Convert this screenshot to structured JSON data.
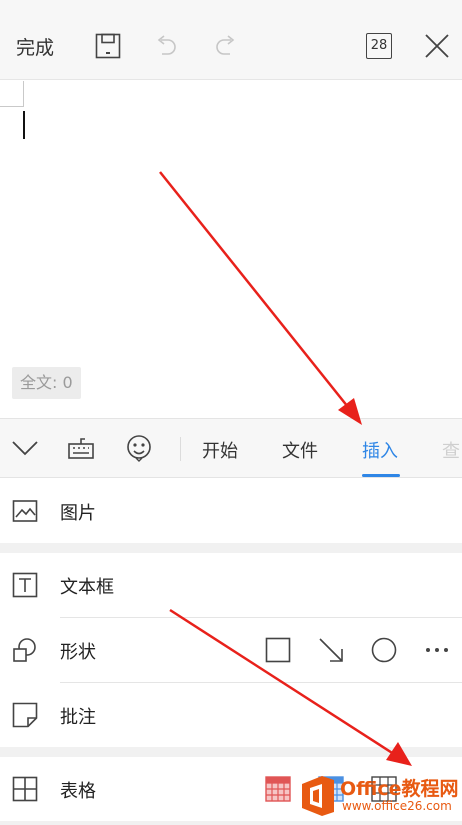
{
  "topbar": {
    "done_label": "完成",
    "page_count": "28",
    "icons": [
      "save-icon",
      "undo-icon",
      "redo-icon",
      "page-count-icon",
      "close-icon"
    ]
  },
  "document": {
    "word_count": "全文: 0"
  },
  "tabbar": {
    "icons": [
      "chevron-down-icon",
      "keyboard-icon",
      "emoji-icon"
    ],
    "tabs": [
      {
        "label": "开始"
      },
      {
        "label": "文件"
      },
      {
        "label": "插入"
      },
      {
        "label": "查"
      }
    ],
    "active_tab": "插入",
    "accent_color": "#2f86e6"
  },
  "insert_menu": {
    "items": [
      {
        "label": "图片",
        "icon": "picture-icon"
      },
      {
        "label": "文本框",
        "icon": "textbox-icon"
      },
      {
        "label": "形状",
        "icon": "shapes-icon",
        "options": [
          "square-shape-icon",
          "arrow-shape-icon",
          "circle-shape-icon",
          "more-icon"
        ]
      },
      {
        "label": "批注",
        "icon": "comment-icon"
      },
      {
        "label": "表格",
        "icon": "table-icon",
        "options": [
          "table-red-icon",
          "table-blue-icon",
          "table-gray-icon"
        ]
      }
    ]
  },
  "annotation": {
    "arrow_color": "#e8211b"
  },
  "watermark": {
    "title": "Office教程网",
    "url": "www.office26.com"
  }
}
